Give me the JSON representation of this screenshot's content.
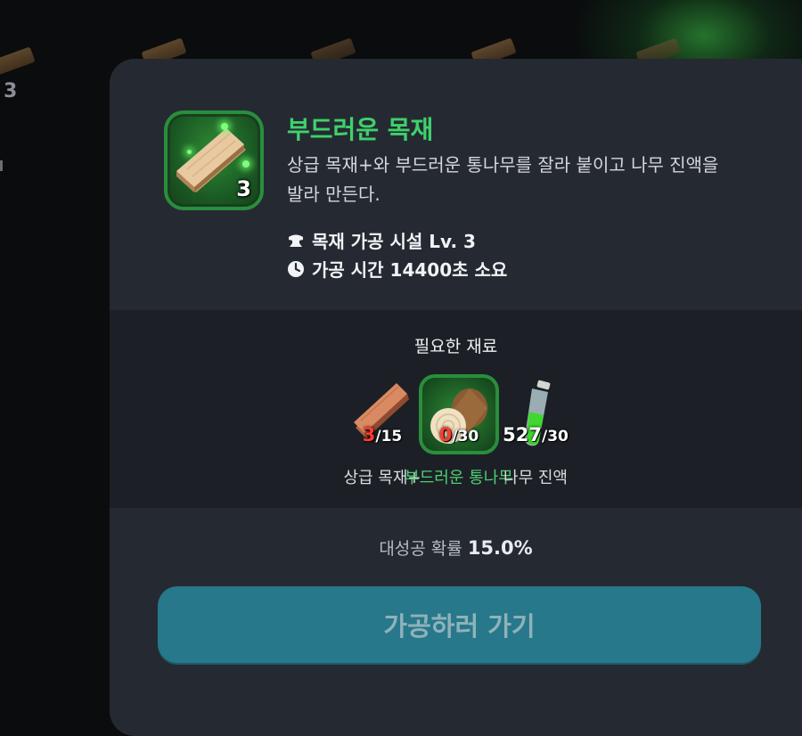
{
  "background": {
    "count_label": "3"
  },
  "item": {
    "name": "부드러운 목재",
    "description": "상급 목재+와 부드러운 통나무를 잘라 붙이고 나무 진액을 발라 만든다.",
    "count": "3",
    "facility": "목재 가공 시설 Lv. 3",
    "time": "가공 시간 14400초 소요",
    "facility_icon": "anvil-icon",
    "time_icon": "clock-icon"
  },
  "materials": {
    "heading": "필요한 재료",
    "list": [
      {
        "name": "상급 목재+",
        "have": "3",
        "need": "/15",
        "have_color": "#ff3b2e",
        "icon": "plank-icon"
      },
      {
        "name": "부드러운 통나무",
        "have": "0",
        "need": "/30",
        "have_color": "#ff3b2e",
        "icon": "log-icon"
      },
      {
        "name": "나무 진액",
        "have": "527",
        "need": "/30",
        "have_color": "#ffffff",
        "icon": "potion-icon"
      }
    ]
  },
  "success": {
    "label": "대성공 확률",
    "value": "15.0%"
  },
  "action": {
    "button_label": "가공하러 가기"
  },
  "colors": {
    "accent_green": "#3ed16b",
    "button": "#27788a",
    "panel": "#252a32"
  }
}
